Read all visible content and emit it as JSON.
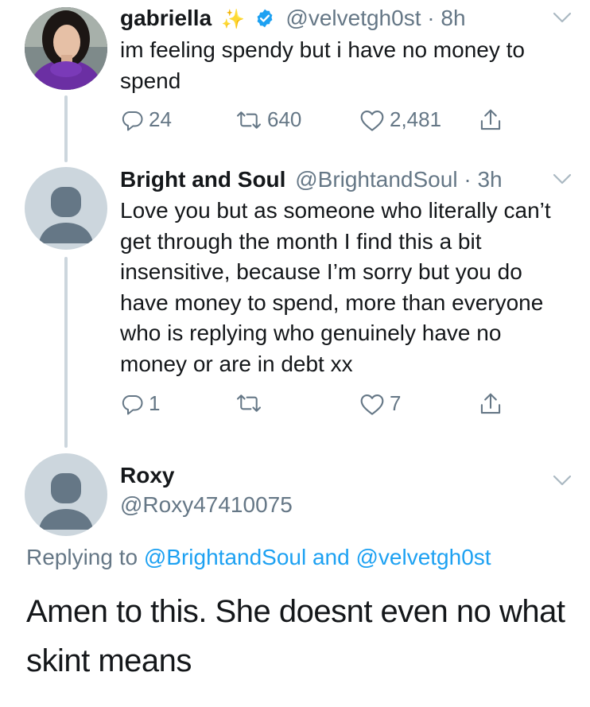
{
  "tweets": [
    {
      "name": "gabriella",
      "name_emoji": "✨",
      "verified": true,
      "handle": "@velvetgh0st",
      "time": "8h",
      "text": "im feeling spendy but i have no money to spend",
      "replies": "24",
      "retweets": "640",
      "likes": "2,481"
    },
    {
      "name": "Bright and Soul",
      "handle": "@BrightandSoul",
      "time": "3h",
      "text": "Love you but as someone who literally can’t get through the month I find this a bit insensitive, because I’m sorry but you do have money to spend, more than everyone who is replying who genuinely have no money or are in debt xx",
      "replies": "1",
      "retweets": "",
      "likes": "7"
    }
  ],
  "reply": {
    "name": "Roxy",
    "handle": "@Roxy47410075",
    "replying_prefix": "Replying to",
    "mention1": "@BrightandSoul",
    "conj": "and",
    "mention2": "@velvetgh0st",
    "text": "Amen to this. She doesnt even no what skint means"
  },
  "separator": "·",
  "colors": {
    "accent": "#1da1f2",
    "muted": "#657786",
    "thread_line": "#ccd6dd"
  },
  "icons": [
    "reply-icon",
    "retweet-icon",
    "like-icon",
    "share-icon",
    "chevron-down-icon",
    "verified-badge-icon",
    "sparkles-emoji"
  ]
}
